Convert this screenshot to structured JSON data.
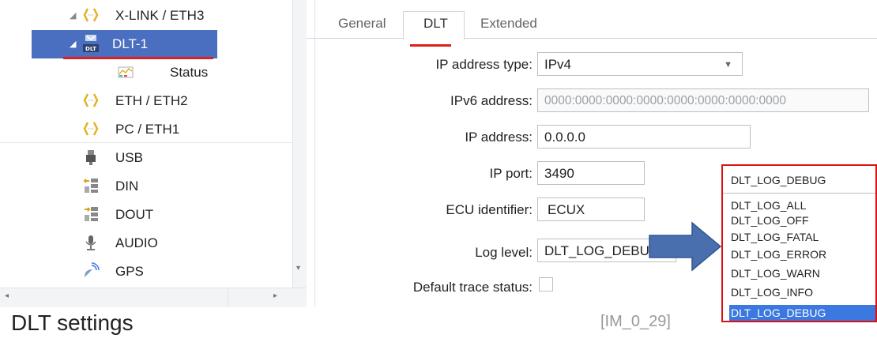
{
  "tree": {
    "items": [
      {
        "label": "X-LINK / ETH3",
        "icon": "network-bracket-icon"
      },
      {
        "label": "DLT-1",
        "icon": "dlt-icon",
        "badge": "DLT"
      },
      {
        "label": "Status",
        "icon": "status-chart-icon"
      },
      {
        "label": "ETH / ETH2",
        "icon": "network-bracket-icon"
      },
      {
        "label": "PC / ETH1",
        "icon": "network-bracket-icon"
      },
      {
        "label": "USB",
        "icon": "usb-plug-icon"
      },
      {
        "label": "DIN",
        "icon": "digital-in-icon"
      },
      {
        "label": "DOUT",
        "icon": "digital-out-icon"
      },
      {
        "label": "AUDIO",
        "icon": "microphone-icon"
      },
      {
        "label": "GPS",
        "icon": "gps-satellite-icon"
      }
    ]
  },
  "tabs": [
    "General",
    "DLT",
    "Extended"
  ],
  "active_tab": "DLT",
  "form": {
    "ip_type_label": "IP address type:",
    "ip_type_value": "IPv4",
    "ipv6_label": "IPv6 address:",
    "ipv6_value": "0000:0000:0000:0000:0000:0000:0000:0000",
    "ip_label": "IP address:",
    "ip_value": "0.0.0.0",
    "port_label": "IP port:",
    "port_value": "3490",
    "ecu_label": "ECU identifier:",
    "ecu_value": "ECUX",
    "log_label": "Log level:",
    "log_value": "DLT_LOG_DEBUG",
    "trace_label": "Default trace status:"
  },
  "dropdown": {
    "current": "DLT_LOG_DEBUG",
    "options": [
      "DLT_LOG_ALL",
      "DLT_LOG_OFF",
      "DLT_LOG_FATAL",
      "DLT_LOG_ERROR",
      "DLT_LOG_WARN",
      "DLT_LOG_INFO",
      "DLT_LOG_DEBUG"
    ],
    "selected": "DLT_LOG_DEBUG"
  },
  "caption": "DLT settings",
  "ref": "[IM_0_29]",
  "colors": {
    "selection": "#4a6fc0",
    "highlight_red": "#e11d1d",
    "arrow": "#4a6fae",
    "option_selected": "#3b78e0"
  }
}
